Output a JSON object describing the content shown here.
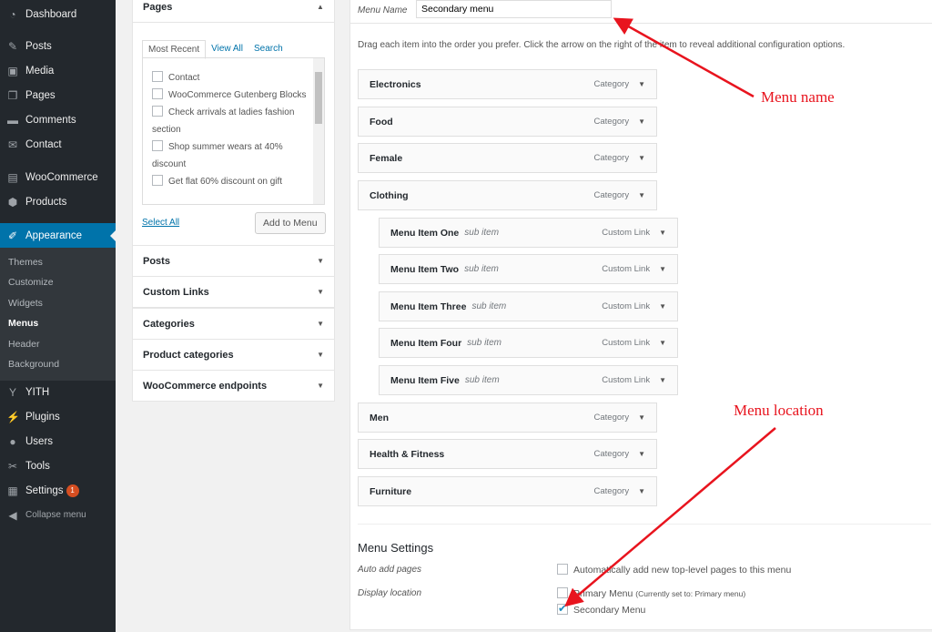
{
  "sidebar": {
    "items": [
      {
        "label": "Dashboard",
        "icon": "dashboard-icon",
        "glyph": "◔"
      },
      {
        "label": "Posts",
        "icon": "pin-icon",
        "glyph": "✎"
      },
      {
        "label": "Media",
        "icon": "media-icon",
        "glyph": "▣"
      },
      {
        "label": "Pages",
        "icon": "pages-icon",
        "glyph": "❐"
      },
      {
        "label": "Comments",
        "icon": "comment-icon",
        "glyph": "▬"
      },
      {
        "label": "Contact",
        "icon": "mail-icon",
        "glyph": "✉"
      },
      {
        "label": "WooCommerce",
        "icon": "woo-icon",
        "glyph": "▤"
      },
      {
        "label": "Products",
        "icon": "box-icon",
        "glyph": "⬢"
      },
      {
        "label": "Appearance",
        "icon": "brush-icon",
        "glyph": "✐"
      },
      {
        "label": "YITH",
        "icon": "yith-icon",
        "glyph": "Y"
      },
      {
        "label": "Plugins",
        "icon": "plug-icon",
        "glyph": "⚡"
      },
      {
        "label": "Users",
        "icon": "user-icon",
        "glyph": "●"
      },
      {
        "label": "Tools",
        "icon": "wrench-icon",
        "glyph": "✂"
      },
      {
        "label": "Settings",
        "icon": "settings-icon",
        "glyph": "▦",
        "badge": "1"
      },
      {
        "label": "Collapse menu",
        "icon": "collapse-icon",
        "glyph": "◀"
      }
    ],
    "submenu": [
      "Themes",
      "Customize",
      "Widgets",
      "Menus",
      "Header",
      "Background"
    ]
  },
  "left": {
    "pages_title": "Pages",
    "tabs": [
      "Most Recent",
      "View All",
      "Search"
    ],
    "pages": [
      {
        "label": "Contact"
      },
      {
        "label": "WooCommerce Gutenberg Blocks"
      },
      {
        "label": "Check arrivals at ladies fashion section"
      },
      {
        "label": "Shop summer wears at 40% discount"
      },
      {
        "label": "Get flat 60% discount on gift"
      }
    ],
    "select_all": "Select All",
    "add_to_menu": "Add to Menu",
    "sections": [
      "Posts",
      "Custom Links",
      "Categories",
      "Product categories",
      "WooCommerce endpoints"
    ]
  },
  "main": {
    "menu_name_label": "Menu Name",
    "menu_name_value": "Secondary menu",
    "instructions": "Drag each item into the order you prefer. Click the arrow on the right of the item to reveal additional configuration options.",
    "items": [
      {
        "title": "Electronics",
        "type": "Category"
      },
      {
        "title": "Food",
        "type": "Category"
      },
      {
        "title": "Female",
        "type": "Category"
      },
      {
        "title": "Clothing",
        "type": "Category"
      },
      {
        "title": "Menu Item One",
        "sub": "sub item",
        "type": "Custom Link"
      },
      {
        "title": "Menu Item Two",
        "sub": "sub item",
        "type": "Custom Link"
      },
      {
        "title": "Menu Item Three",
        "sub": "sub item",
        "type": "Custom Link"
      },
      {
        "title": "Menu Item Four",
        "sub": "sub item",
        "type": "Custom Link"
      },
      {
        "title": "Menu Item Five",
        "sub": "sub item",
        "type": "Custom Link"
      },
      {
        "title": "Men",
        "type": "Category"
      },
      {
        "title": "Health & Fitness",
        "type": "Category"
      },
      {
        "title": "Furniture",
        "type": "Category"
      }
    ],
    "settings": {
      "title": "Menu Settings",
      "auto_label": "Auto add pages",
      "auto_option": "Automatically add new top-level pages to this menu",
      "auto_checked": false,
      "location_label": "Display location",
      "locations": [
        {
          "label": "Primary Menu",
          "note": "(Currently set to: Primary menu)",
          "checked": false
        },
        {
          "label": "Secondary Menu",
          "note": "",
          "checked": true
        }
      ]
    }
  },
  "annotations": {
    "menu_name": "Menu name",
    "menu_location": "Menu location",
    "color": "#e8141e"
  }
}
